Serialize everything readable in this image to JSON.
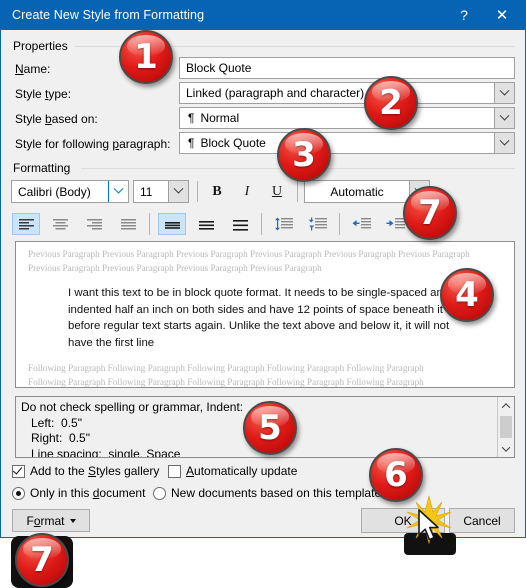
{
  "window": {
    "title": "Create New Style from Formatting",
    "help_label": "?",
    "close_label": "✕",
    "titlebar_color": "#0763b4"
  },
  "properties": {
    "group_label": "Properties",
    "name_label": "Name:",
    "name_value": "Block Quote",
    "style_type_label": "Style type:",
    "style_type_value": "Linked (paragraph and character)",
    "style_based_on_label": "Style based on:",
    "style_based_on_value": "Normal",
    "style_following_label": "Style for following paragraph:",
    "style_following_value": "Block Quote",
    "pilcrow": "¶"
  },
  "formatting": {
    "group_label": "Formatting",
    "font_family": "Calibri (Body)",
    "font_size": "11",
    "bold_label": "B",
    "italic_label": "I",
    "underline_label": "U",
    "font_color": "Automatic",
    "align_buttons": [
      {
        "name": "align-left",
        "selected": true
      },
      {
        "name": "align-center",
        "selected": false
      },
      {
        "name": "align-right",
        "selected": false
      },
      {
        "name": "align-justify",
        "selected": false
      }
    ],
    "spacing_buttons": [
      {
        "name": "line-spacing-single",
        "selected": true
      },
      {
        "name": "line-spacing-1-5",
        "selected": false
      },
      {
        "name": "line-spacing-double",
        "selected": false
      }
    ],
    "space_buttons": [
      {
        "name": "increase-paragraph-spacing",
        "selected": false
      },
      {
        "name": "decrease-paragraph-spacing",
        "selected": false
      }
    ],
    "indent_buttons": [
      {
        "name": "decrease-indent",
        "selected": false
      },
      {
        "name": "increase-indent",
        "selected": false
      }
    ]
  },
  "preview": {
    "previous_paragraph": "Previous Paragraph Previous Paragraph Previous Paragraph Previous Paragraph Previous Paragraph Previous Paragraph Previous Paragraph Previous Paragraph Previous Paragraph Previous Paragraph",
    "body_text": "I want this text to be in block quote format.  It needs to be single-spaced and indented half an inch on both sides and have 12 points of space beneath it before regular text starts again. Unlike the text above and below it, it will not have the first line",
    "following_paragraph_line": "Following Paragraph Following Paragraph Following Paragraph Following Paragraph Following Paragraph",
    "following_line_count": 5
  },
  "description": {
    "lines": [
      "Do not check spelling or grammar, Indent:",
      "   Left:  0.5\"",
      "   Right:  0.5\"",
      "   Line spacing:  single, Space"
    ]
  },
  "options": {
    "add_to_gallery_label": "Add to the Styles gallery",
    "add_to_gallery_checked": true,
    "auto_update_label": "Automatically update",
    "auto_update_checked": false,
    "only_this_document_label": "Only in this document",
    "only_this_document_selected": true,
    "new_documents_label": "New documents based on this template",
    "new_documents_selected": false
  },
  "buttons": {
    "format_label": "Format",
    "ok_label": "OK",
    "cancel_label": "Cancel"
  },
  "badges": [
    {
      "id": 1,
      "label": "1"
    },
    {
      "id": 2,
      "label": "2"
    },
    {
      "id": 3,
      "label": "3"
    },
    {
      "id": 4,
      "label": "4"
    },
    {
      "id": 5,
      "label": "5"
    },
    {
      "id": 6,
      "label": "6"
    },
    {
      "id": 7,
      "label": "7"
    },
    {
      "id": 8,
      "label": "7"
    }
  ]
}
